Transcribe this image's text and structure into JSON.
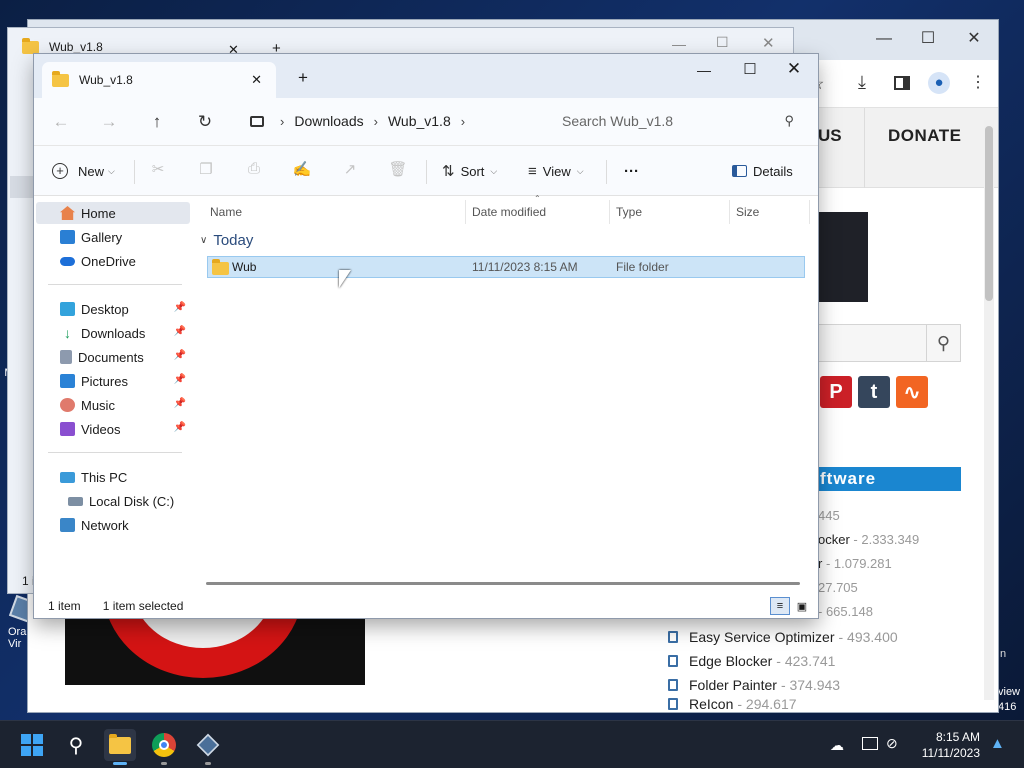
{
  "desktop": {
    "left_icon_label_top": "M",
    "left_icon_label_bottom1": "Ora",
    "left_icon_label_bottom2": "Vir",
    "right_text1": "view",
    "right_text2": "416",
    "right_text_n": "n"
  },
  "browser_back": {
    "tab_title": "Wub_v1.8",
    "nav_us": "US",
    "nav_donate": "DONATE",
    "software_header": "ftware",
    "stats": [
      {
        "value": "445"
      },
      {
        "prefix": "ocker",
        "value": " - 2.333.349"
      },
      {
        "prefix": "r",
        "value": " - 1.079.281"
      },
      {
        "value": "27.705"
      },
      {
        "value": "- 665.148"
      }
    ],
    "programs": [
      {
        "name": "Easy Service Optimizer",
        "count": "- 493.400"
      },
      {
        "name": "Edge Blocker",
        "count": "- 423.741"
      },
      {
        "name": "Folder Painter",
        "count": "- 374.943"
      },
      {
        "name": "ReIcon",
        "count": "- 294.617"
      }
    ]
  },
  "explorer_back": {
    "tab_title": "Wub_v1.8",
    "status_count": "1 i"
  },
  "explorer": {
    "tab_title": "Wub_v1.8",
    "new_tab_symbol": "+",
    "breadcrumbs": [
      "Downloads",
      "Wub_v1.8"
    ],
    "search_placeholder": "Search Wub_v1.8",
    "commands": {
      "new": "New",
      "sort": "Sort",
      "view": "View",
      "more": "···",
      "details": "Details"
    },
    "nav": {
      "home": "Home",
      "gallery": "Gallery",
      "onedrive": "OneDrive",
      "desktop": "Desktop",
      "downloads": "Downloads",
      "documents": "Documents",
      "pictures": "Pictures",
      "music": "Music",
      "videos": "Videos",
      "this_pc": "This PC",
      "local_disk": "Local Disk (C:)",
      "network": "Network"
    },
    "columns": {
      "name": "Name",
      "date_modified": "Date modified",
      "type": "Type",
      "size": "Size"
    },
    "group": "Today",
    "files": [
      {
        "name": "Wub",
        "date_modified": "11/11/2023 8:15 AM",
        "type": "File folder",
        "size": ""
      }
    ],
    "status": {
      "item_count": "1 item",
      "selected": "1 item selected"
    }
  },
  "taskbar": {
    "time": "8:15 AM",
    "date": "11/11/2023"
  },
  "colors": {
    "selection": "#cce4f7",
    "accent": "#0067c0",
    "software_bar": "#1a86d0"
  }
}
